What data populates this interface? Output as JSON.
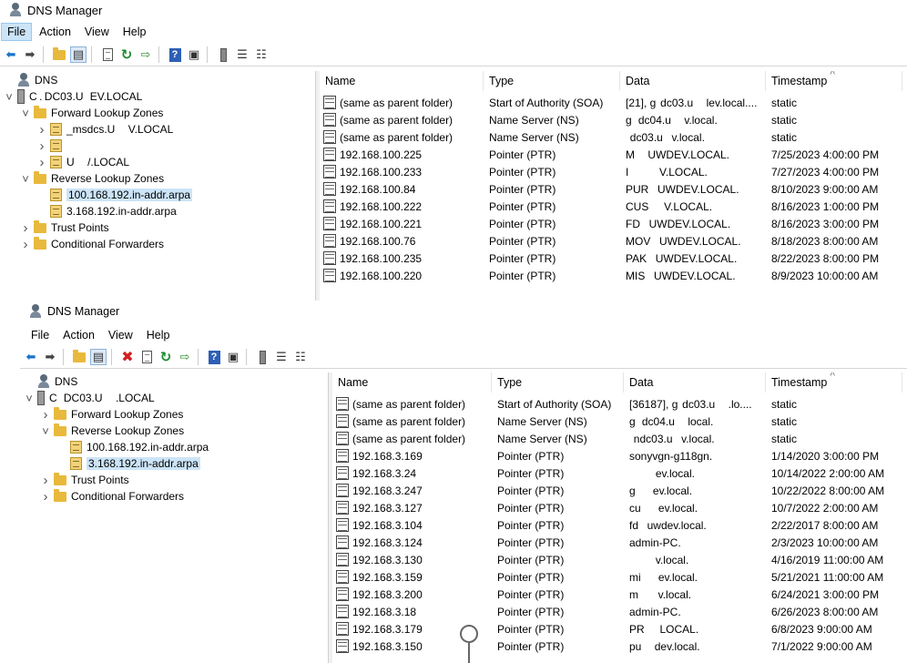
{
  "windows": [
    {
      "title": "DNS Manager",
      "menu": [
        "File",
        "Action",
        "View",
        "Help"
      ],
      "active_menu": 0,
      "toolbar": [
        "back-arrow-icon",
        "forward-arrow-icon",
        "up-folder-icon",
        "show-hide-tree-icon",
        "properties-icon",
        "refresh-icon",
        "export-list-icon",
        "help-icon",
        "console-icon",
        "server-icon",
        "list-icon",
        "details-icon"
      ],
      "tree": [
        {
          "label": "DNS",
          "level": 0,
          "twisty": "",
          "icon": "dns"
        },
        {
          "label": "C . DC03.U   EV.LOCAL",
          "level": 0,
          "twisty": "v",
          "icon": "server"
        },
        {
          "label": "Forward Lookup Zones",
          "level": 1,
          "twisty": "v",
          "icon": "folder"
        },
        {
          "label": "_msdcs.U      V.LOCAL",
          "level": 2,
          "twisty": ">",
          "icon": "zone"
        },
        {
          "label": "",
          "level": 2,
          "twisty": ">",
          "icon": "zone"
        },
        {
          "label": "U      /.LOCAL",
          "level": 2,
          "twisty": ">",
          "icon": "zone"
        },
        {
          "label": "Reverse Lookup Zones",
          "level": 1,
          "twisty": "v",
          "icon": "folder"
        },
        {
          "label": "100.168.192.in-addr.arpa",
          "level": 2,
          "twisty": "",
          "icon": "zone",
          "selected": true
        },
        {
          "label": "3.168.192.in-addr.arpa",
          "level": 2,
          "twisty": "",
          "icon": "zone"
        },
        {
          "label": "Trust Points",
          "level": 1,
          "twisty": ">",
          "icon": "folder"
        },
        {
          "label": "Conditional Forwarders",
          "level": 1,
          "twisty": ">",
          "icon": "folder"
        }
      ],
      "columns": [
        "Name",
        "Type",
        "Data",
        "Timestamp"
      ],
      "records": [
        [
          "(same as parent folder)",
          "Start of Authority (SOA)",
          "[21], g  dc03.u      lev.local....",
          "static"
        ],
        [
          "(same as parent folder)",
          "Name Server (NS)",
          "g   dc04.u      v.local.",
          "static"
        ],
        [
          "(same as parent folder)",
          "Name Server (NS)",
          "  dc03.u    v.local.",
          "static"
        ],
        [
          "192.168.100.225",
          "Pointer (PTR)",
          "M      UWDEV.LOCAL.",
          "7/25/2023 4:00:00 PM"
        ],
        [
          "192.168.100.233",
          "Pointer (PTR)",
          "I              V.LOCAL.",
          "7/27/2023 4:00:00 PM"
        ],
        [
          "192.168.100.84",
          "Pointer (PTR)",
          "PUR    UWDEV.LOCAL.",
          "8/10/2023 9:00:00 AM"
        ],
        [
          "192.168.100.222",
          "Pointer (PTR)",
          "CUS       V.LOCAL.",
          "8/16/2023 1:00:00 PM"
        ],
        [
          "192.168.100.221",
          "Pointer (PTR)",
          "FD    UWDEV.LOCAL.",
          "8/16/2023 3:00:00 PM"
        ],
        [
          "192.168.100.76",
          "Pointer (PTR)",
          "MOV    UWDEV.LOCAL.",
          "8/18/2023 8:00:00 AM"
        ],
        [
          "192.168.100.235",
          "Pointer (PTR)",
          "PAK    UWDEV.LOCAL.",
          "8/22/2023 8:00:00 PM"
        ],
        [
          "192.168.100.220",
          "Pointer (PTR)",
          "MIS    UWDEV.LOCAL.",
          "8/9/2023 10:00:00 AM"
        ]
      ]
    },
    {
      "title": "DNS Manager",
      "menu": [
        "File",
        "Action",
        "View",
        "Help"
      ],
      "active_menu": -1,
      "toolbar": [
        "back-arrow-icon",
        "forward-arrow-icon",
        "up-folder-icon",
        "show-hide-tree-icon",
        "delete-icon",
        "properties-icon",
        "refresh-icon",
        "export-list-icon",
        "help-icon",
        "console-icon",
        "server-icon",
        "list-icon",
        "details-icon"
      ],
      "tree": [
        {
          "label": "DNS",
          "level": 0,
          "twisty": "",
          "icon": "dns"
        },
        {
          "label": "C   DC03.U      .LOCAL",
          "level": 0,
          "twisty": "v",
          "icon": "server"
        },
        {
          "label": "Forward Lookup Zones",
          "level": 1,
          "twisty": ">",
          "icon": "folder"
        },
        {
          "label": "Reverse Lookup Zones",
          "level": 1,
          "twisty": "v",
          "icon": "folder"
        },
        {
          "label": "100.168.192.in-addr.arpa",
          "level": 2,
          "twisty": "",
          "icon": "zone"
        },
        {
          "label": "3.168.192.in-addr.arpa",
          "level": 2,
          "twisty": "",
          "icon": "zone",
          "selected": true
        },
        {
          "label": "Trust Points",
          "level": 1,
          "twisty": ">",
          "icon": "folder"
        },
        {
          "label": "Conditional Forwarders",
          "level": 1,
          "twisty": ">",
          "icon": "folder"
        }
      ],
      "columns": [
        "Name",
        "Type",
        "Data",
        "Timestamp"
      ],
      "records": [
        [
          "(same as parent folder)",
          "Start of Authority (SOA)",
          "[36187], g  dc03.u      .lo....",
          "static"
        ],
        [
          "(same as parent folder)",
          "Name Server (NS)",
          "g   dc04.u      local.",
          "static"
        ],
        [
          "(same as parent folder)",
          "Name Server (NS)",
          "  ndc03.u    v.local.",
          "static"
        ],
        [
          "192.168.3.169",
          "Pointer (PTR)",
          "sonyvgn-g118gn.",
          "1/14/2020 3:00:00 PM"
        ],
        [
          "192.168.3.24",
          "Pointer (PTR)",
          "            ev.local.",
          "10/14/2022 2:00:00 AM"
        ],
        [
          "192.168.3.247",
          "Pointer (PTR)",
          "g        ev.local.",
          "10/22/2022 8:00:00 AM"
        ],
        [
          "192.168.3.127",
          "Pointer (PTR)",
          "cu        ev.local.",
          "10/7/2022 2:00:00 AM"
        ],
        [
          "192.168.3.104",
          "Pointer (PTR)",
          "fd    uwdev.local.",
          "2/22/2017 8:00:00 AM"
        ],
        [
          "192.168.3.124",
          "Pointer (PTR)",
          "admin-PC.",
          "2/3/2023 10:00:00 AM"
        ],
        [
          "192.168.3.130",
          "Pointer (PTR)",
          "            v.local.",
          "4/16/2019 11:00:00 AM"
        ],
        [
          "192.168.3.159",
          "Pointer (PTR)",
          "mi        ev.local.",
          "5/21/2021 11:00:00 AM"
        ],
        [
          "192.168.3.200",
          "Pointer (PTR)",
          "m         v.local.",
          "6/24/2021 3:00:00 PM"
        ],
        [
          "192.168.3.18",
          "Pointer (PTR)",
          "admin-PC.",
          "6/26/2023 8:00:00 AM"
        ],
        [
          "192.168.3.179",
          "Pointer (PTR)",
          "PR       LOCAL.",
          "6/8/2023 9:00:00 AM"
        ],
        [
          "192.168.3.150",
          "Pointer (PTR)",
          "pu      dev.local.",
          "7/1/2022 9:00:00 AM"
        ]
      ]
    }
  ]
}
